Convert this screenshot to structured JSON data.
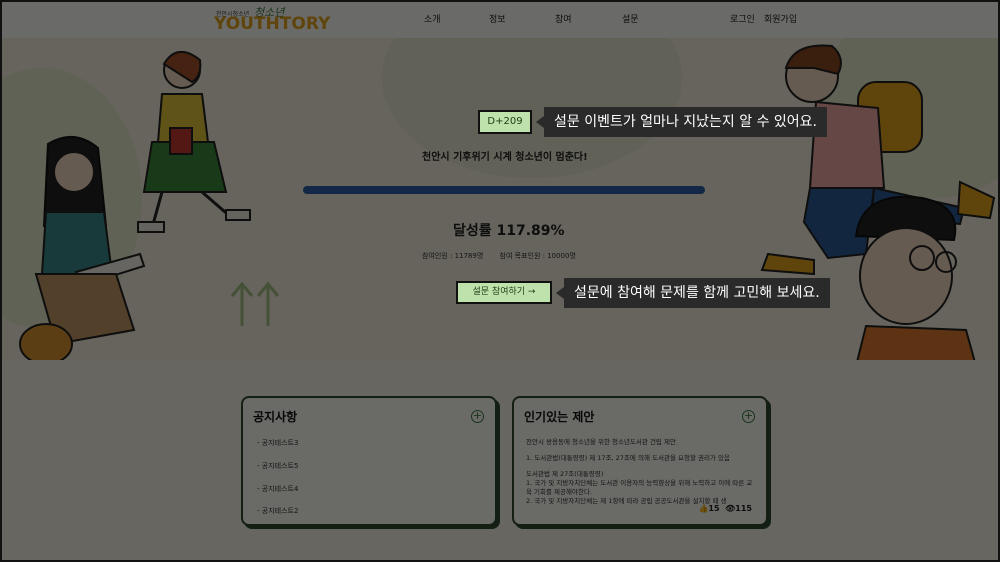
{
  "header": {
    "logo_small": "천안시청소년",
    "logo_script": "청소년",
    "logo_main": "YOUTHTORY",
    "nav": [
      "소개",
      "정보",
      "참여",
      "설문"
    ],
    "login": "로그인",
    "signup": "회원가입"
  },
  "hero": {
    "dday": "D+209",
    "dday_tooltip": "설문 이벤트가 얼마나 지났는지 알 수 있어요.",
    "headline": "천안시 기후위기 시계 청소년이 멈춘다!",
    "rate_label": "달성률 117.89%",
    "participants": "참여인원 : 11789명",
    "target": "참여 목표인원 : 10000명",
    "join_button": "설문 참여하기 →",
    "join_tooltip": "설문에 참여해 문제를 함께 고민해 보세요.",
    "progress": 1.0
  },
  "notice": {
    "title": "공지사항",
    "items": [
      "- 공지테스트3",
      "- 공지테스트5",
      "- 공지테스트4",
      "- 공지테스트2"
    ]
  },
  "popular": {
    "title": "인기있는 제안",
    "lines": [
      "천안시 쌍용동에 청소년을 위한 청소년도서관 건립 제안",
      "1. 도서관법(대통령령) 제 17조, 27조에 의해 도서관을 요청할 권리가 있음",
      "도서관법 제 27조(대통령령)",
      "1. 국가 및 지방자치단체는 도서관 이용자의 능력향상을 위해 노력하고 이에 따른 교육 기회를 제공해야한다.",
      "2. 국가 및 지방자치단체는 제 1항에 따라 공립 공공도서관을 설치할 때 생"
    ],
    "likes": "15",
    "views": "115"
  },
  "colors": {
    "accent_green": "#bfe2ad",
    "progress_blue": "#2c5fa8",
    "logo_orange": "#e2a21b",
    "card_border": "#2d4a2d"
  }
}
